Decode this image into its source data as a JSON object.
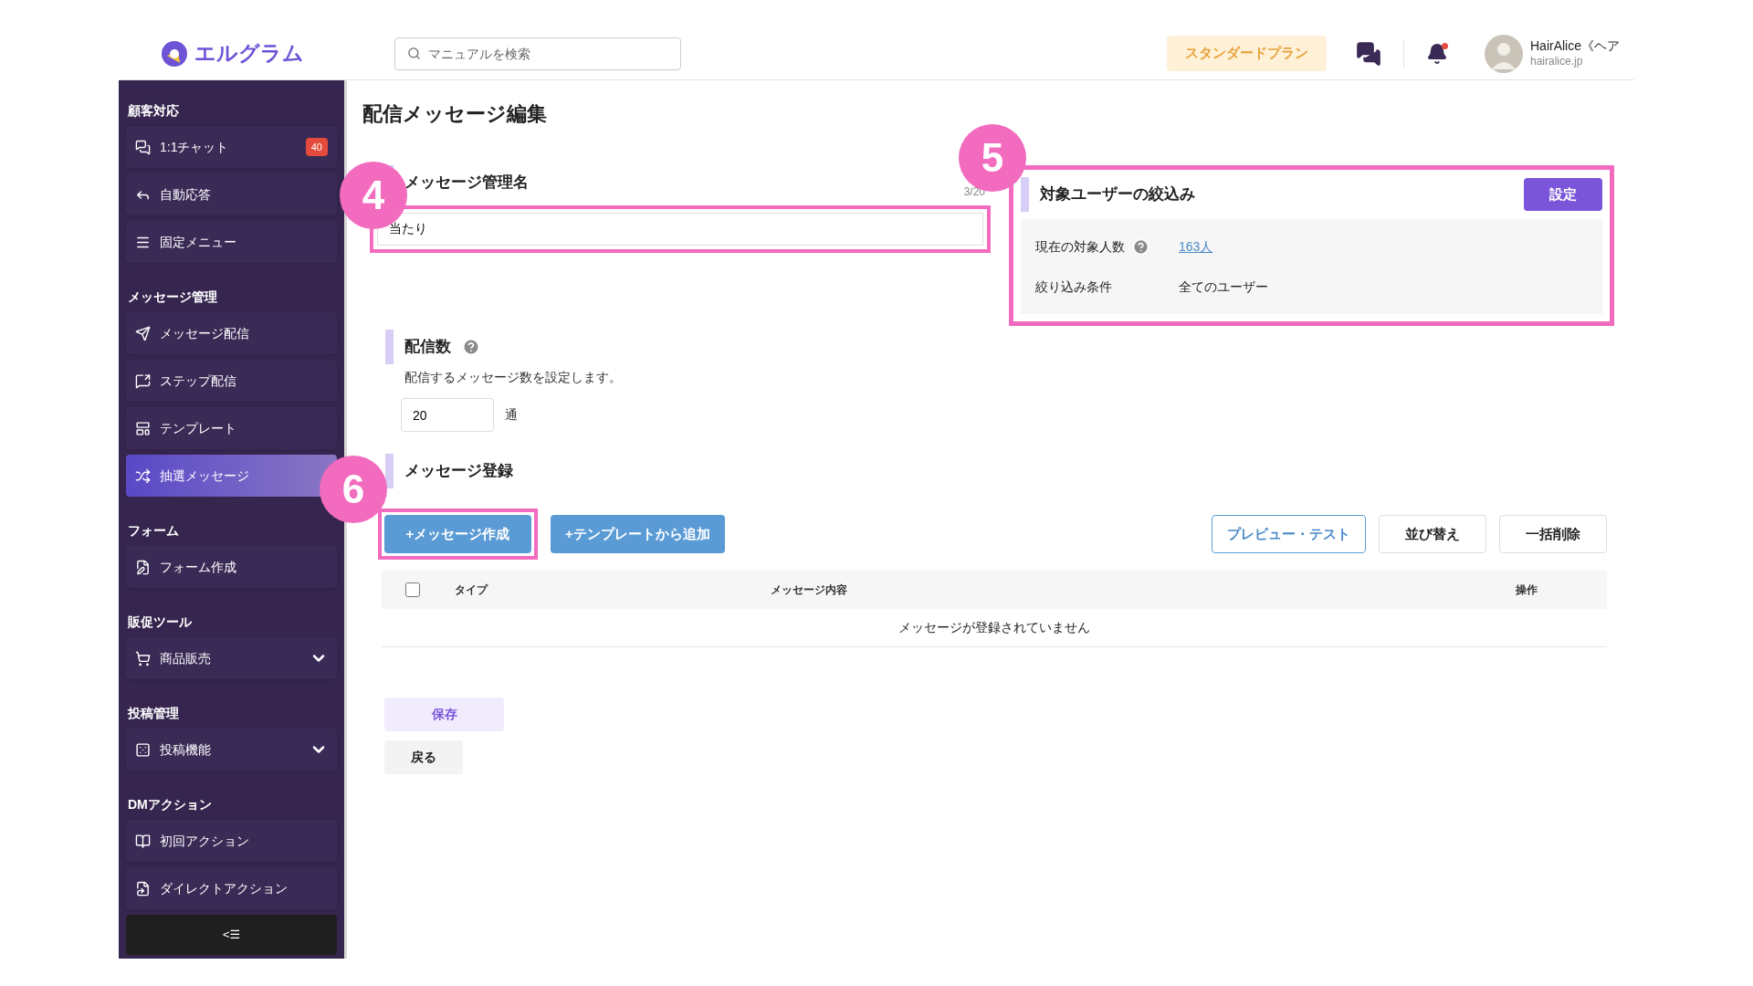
{
  "header": {
    "logo_text": "エルグラム",
    "search": {
      "placeholder": "マニュアルを検索"
    },
    "plan_badge": "スタンダードプラン",
    "user": {
      "name": "HairAlice《ヘア",
      "domain": "hairalice.jp"
    },
    "notification_dot": true
  },
  "sidebar": {
    "sections": [
      {
        "title": "顧客対応",
        "items": [
          {
            "label": "1:1チャット",
            "kind": "link",
            "selected": false,
            "badge": "40"
          },
          {
            "label": "自動応答",
            "kind": "link",
            "selected": false
          },
          {
            "label": "固定メニュー",
            "kind": "link",
            "selected": false
          }
        ]
      },
      {
        "title": "メッセージ管理",
        "items": [
          {
            "label": "メッセージ配信",
            "kind": "link",
            "selected": false
          },
          {
            "label": "ステップ配信",
            "kind": "link",
            "selected": false
          },
          {
            "label": "テンプレート",
            "kind": "link",
            "selected": false
          },
          {
            "label": "抽選メッセージ",
            "kind": "link",
            "selected": true
          }
        ]
      },
      {
        "title": "フォーム",
        "items": [
          {
            "label": "フォーム作成",
            "kind": "link",
            "selected": false
          }
        ]
      },
      {
        "title": "販促ツール",
        "items": [
          {
            "label": "商品販売",
            "kind": "menu",
            "selected": false
          }
        ]
      },
      {
        "title": "投稿管理",
        "items": [
          {
            "label": "投稿機能",
            "kind": "menu",
            "selected": false
          }
        ]
      },
      {
        "title": "DMアクション",
        "items": [
          {
            "label": "初回アクション",
            "kind": "link",
            "selected": false
          },
          {
            "label": "ダイレクトアクション",
            "kind": "link",
            "selected": false
          }
        ]
      }
    ],
    "collapse_button": "<☰"
  },
  "page_title": "配信メッセージ編集",
  "name_field": {
    "heading": "メッセージ管理名",
    "counter": "3/20",
    "value": "当たり",
    "callout": "4"
  },
  "target_panel": {
    "heading": "対象ユーザーの絞込み",
    "button": "設定",
    "callout": "5",
    "rows": [
      {
        "label": "現在の対象人数",
        "help": true,
        "kind": "link",
        "value": "163人"
      },
      {
        "label": "絞り込み条件",
        "help": false,
        "kind": "text",
        "value": "全てのユーザー"
      }
    ]
  },
  "delivery_count": {
    "heading": "配信数",
    "help": true,
    "description": "配信するメッセージ数を設定します。",
    "value": "20",
    "unit": "通"
  },
  "registration": {
    "heading": "メッセージ登録",
    "buttons": [
      {
        "label": "+メッセージ作成",
        "kind": "primary",
        "callout": "6"
      },
      {
        "label": "+テンプレートから追加",
        "kind": "primary"
      },
      {
        "label": "プレビュー・テスト",
        "kind": "outline"
      },
      {
        "label": "並び替え",
        "kind": "plain"
      },
      {
        "label": "一括削除",
        "kind": "plain"
      }
    ],
    "table": {
      "select_all_checked": false,
      "columns": [
        "タイプ",
        "メッセージ内容",
        "操作"
      ],
      "empty_text": "メッセージが登録されていません"
    }
  },
  "footer_buttons": [
    {
      "label": "保存",
      "kind": "save"
    },
    {
      "label": "戻る",
      "kind": "back"
    }
  ]
}
